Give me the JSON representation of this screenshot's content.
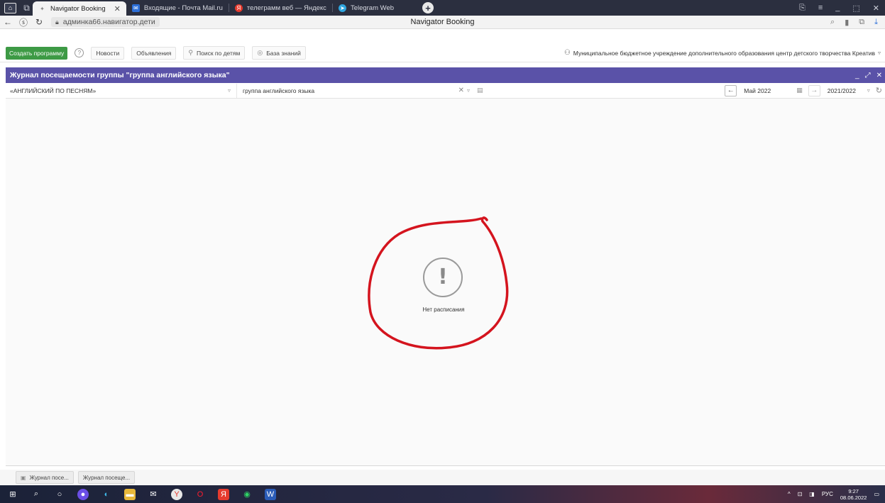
{
  "browser": {
    "tabs": [
      {
        "label": "Navigator Booking",
        "active": true
      },
      {
        "label": "Входящие - Почта Mail.ru",
        "active": false
      },
      {
        "label": "телеграмм веб — Яндекс",
        "active": false
      },
      {
        "label": "Telegram Web",
        "active": false
      }
    ],
    "url": "админка66.навигатор.дети",
    "page_title": "Navigator Booking"
  },
  "toolbar": {
    "create_label": "Создать программу",
    "items": [
      "Новости",
      "Объявления",
      "Поиск по детям",
      "База знаний"
    ],
    "organization": "Муниципальное бюджетное учреждение дополнительного образования центр детского творчества Креатив"
  },
  "panel": {
    "title": "Журнал посещаемости группы \"группа английского языка\""
  },
  "filters": {
    "program": "«АНГЛИЙСКИЙ ПО ПЕСНЯМ»",
    "group": "группа английского языка",
    "month": "Май 2022",
    "year": "2021/2022"
  },
  "empty_state": {
    "message": "Нет расписания"
  },
  "bottom_tabs": [
    "Журнал посе...",
    "Журнал посеще..."
  ],
  "taskbar": {
    "lang": "РУС",
    "time": "9:27",
    "date": "08.06.2022"
  },
  "colors": {
    "panel_header": "#5a52a8",
    "create_button": "#3d9a45",
    "annotation": "#d4141e"
  }
}
